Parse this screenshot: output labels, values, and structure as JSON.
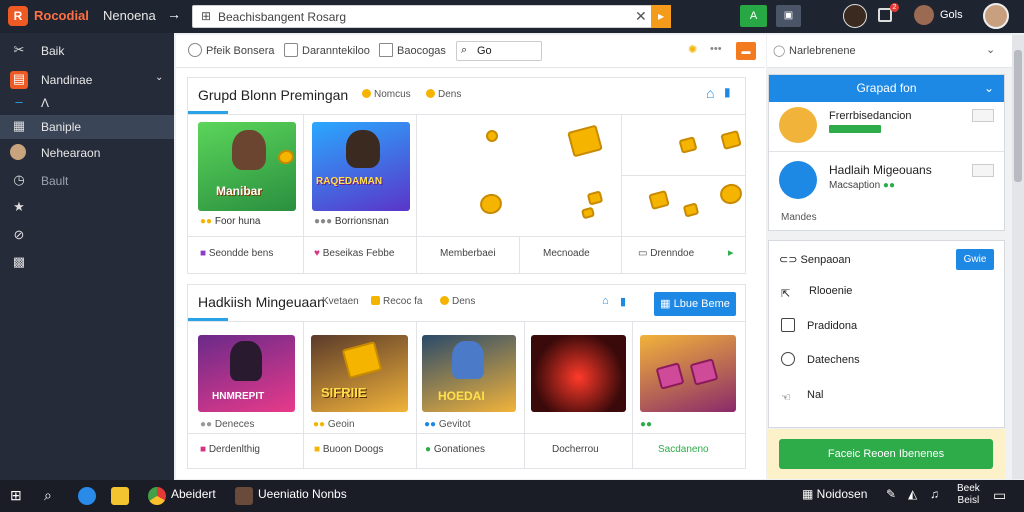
{
  "header": {
    "app_title": "Rocodial",
    "app_subtitle": "Nenoena",
    "url_text": "Beachisbangent Rosarg",
    "user_name": "Gols"
  },
  "sidebar": {
    "items": [
      {
        "label": "Baik",
        "icon": "tools-icon"
      },
      {
        "label": "Nandinae",
        "icon": "store-icon"
      },
      {
        "label": "",
        "icon": "dash-icon"
      },
      {
        "label": "Baniple",
        "icon": "table-icon"
      },
      {
        "label": "Nehearaon",
        "icon": "user-icon"
      },
      {
        "label": "Bault",
        "icon": "clock-icon"
      },
      {
        "label": "",
        "icon": "star-icon"
      },
      {
        "label": "",
        "icon": "globe-icon"
      },
      {
        "label": "",
        "icon": "grid-icon"
      }
    ]
  },
  "toolbar": {
    "items": [
      "Pfeik Bonsera",
      "Daranntekiloo",
      "Baocogas",
      "Go"
    ],
    "right_label": "Narlebrenene"
  },
  "panel1": {
    "title": "Grupd Blonn Premingan",
    "tag1": "Nomcus",
    "tag2": "Dens",
    "cards": [
      {
        "caption": "Foor huna",
        "footer": "Seondde bens"
      },
      {
        "caption": "Borrionsnan",
        "footer": "Beseikas Febbe"
      }
    ],
    "cells": [
      "Memberbaei",
      "Mecnoade",
      "Drenndoe"
    ],
    "card_texts": [
      "Manibar",
      "RAQEDAMAN"
    ]
  },
  "panel2": {
    "title": "Hadkiish Mingeuaan",
    "tag1": "Kvetaen",
    "tag2": "Recoc fa",
    "tag3": "Dens",
    "button": "Lbue Beme",
    "cards": [
      {
        "caption": "Deneces",
        "footer": "Derdenlthig",
        "art": "HNMREPIT"
      },
      {
        "caption": "Geoin",
        "footer": "Buoon Doogs",
        "art": "SIFRIIE"
      },
      {
        "caption": "Gevitot",
        "footer": "Gonationes",
        "art": "HOEDAI"
      },
      {
        "caption": "",
        "footer": "Docherrou",
        "art": ""
      },
      {
        "caption": "",
        "footer": "Sacdaneno",
        "art": ""
      }
    ]
  },
  "right": {
    "group_title": "Grapad fon",
    "members": [
      {
        "name": "Frerrbisedancion",
        "sub": ""
      },
      {
        "name": "Hadlaih Migeouans",
        "sub": "Macsaption"
      }
    ],
    "more": "Mandes",
    "menu_title": "Senpaoan",
    "menu_button": "Gwie",
    "menu_items": [
      "Rlooenie",
      "Pradidona",
      "Datechens",
      "Nal"
    ],
    "cta": "Faceic Reoen Ibenenes"
  },
  "taskbar": {
    "items": [
      "Abeidert",
      "Ueeniatio Nonbs"
    ],
    "tray": [
      "Noidosen"
    ],
    "clock_time": "Beek",
    "clock_date": "Beisl"
  }
}
